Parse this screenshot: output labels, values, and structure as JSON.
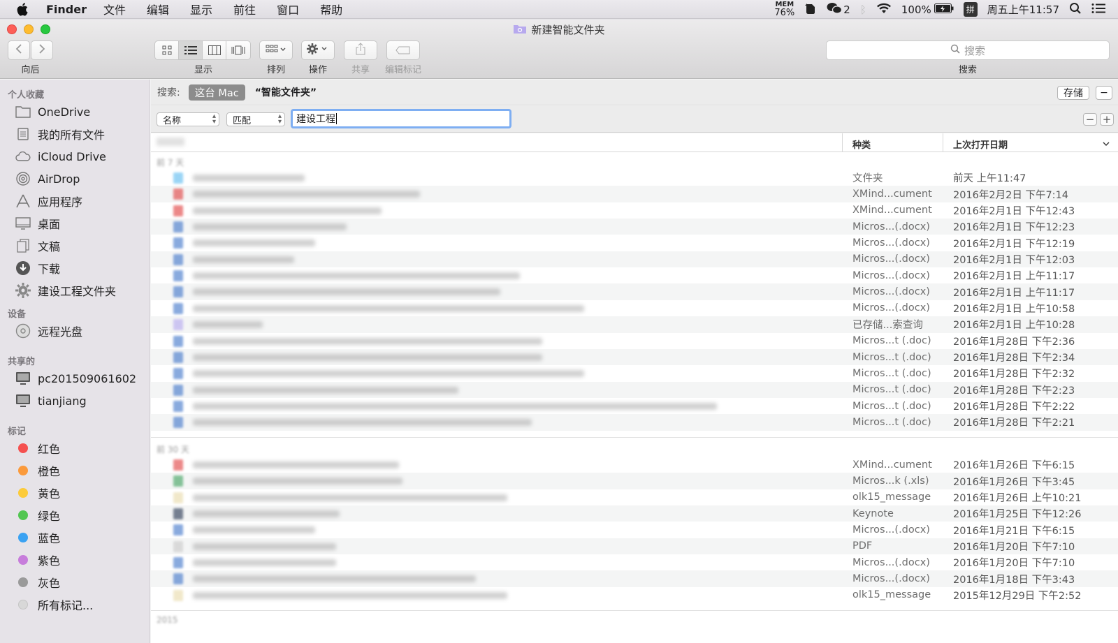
{
  "menubar": {
    "app": "Finder",
    "items": [
      "文件",
      "编辑",
      "显示",
      "前往",
      "窗口",
      "帮助"
    ],
    "mem_label": "MEM",
    "mem_value": "76%",
    "wechat_count": "2",
    "battery": "100%",
    "ime": "拼",
    "clock": "周五上午11:57"
  },
  "window": {
    "title": "新建智能文件夹",
    "toolbar": {
      "back_label": "向后",
      "view_label": "显示",
      "arrange_label": "排列",
      "action_label": "操作",
      "share_label": "共享",
      "tags_label": "编辑标记",
      "search_placeholder": "搜索",
      "search_label": "搜索"
    }
  },
  "sidebar": {
    "favorites_header": "个人收藏",
    "favorites": [
      {
        "label": "OneDrive",
        "icon": "folder-icon"
      },
      {
        "label": "我的所有文件",
        "icon": "all-files-icon"
      },
      {
        "label": "iCloud Drive",
        "icon": "cloud-icon"
      },
      {
        "label": "AirDrop",
        "icon": "airdrop-icon"
      },
      {
        "label": "应用程序",
        "icon": "applications-icon"
      },
      {
        "label": "桌面",
        "icon": "desktop-icon"
      },
      {
        "label": "文稿",
        "icon": "documents-icon"
      },
      {
        "label": "下载",
        "icon": "download-icon"
      },
      {
        "label": "建设工程文件夹",
        "icon": "gear-icon"
      }
    ],
    "devices_header": "设备",
    "devices": [
      {
        "label": "远程光盘",
        "icon": "disc-icon"
      }
    ],
    "shared_header": "共享的",
    "shared": [
      {
        "label": "pc201509061602",
        "icon": "computer-icon"
      },
      {
        "label": "tianjiang",
        "icon": "computer-icon"
      }
    ],
    "tags_header": "标记",
    "tags": [
      {
        "label": "红色",
        "color": "#f5504f"
      },
      {
        "label": "橙色",
        "color": "#fb9a3b"
      },
      {
        "label": "黄色",
        "color": "#fccb3a"
      },
      {
        "label": "绿色",
        "color": "#52c651"
      },
      {
        "label": "蓝色",
        "color": "#3aa2f2"
      },
      {
        "label": "紫色",
        "color": "#c77ddb"
      },
      {
        "label": "灰色",
        "color": "#9a9a9a"
      }
    ],
    "all_tags": "所有标记..."
  },
  "scope": {
    "label": "搜索:",
    "this_mac": "这台 Mac",
    "smart_folder": "“智能文件夹”",
    "save": "存储",
    "minus": "−"
  },
  "criteria": {
    "attribute": "名称",
    "operator": "匹配",
    "value": "建设工程",
    "minus": "−",
    "plus": "+"
  },
  "list": {
    "col_kind": "种类",
    "col_date": "上次打开日期",
    "group1": "前 7 天",
    "group2": "前 30 天",
    "group3": "2015",
    "rows1": [
      {
        "kind": "文件夹",
        "date": "前天 上午11:47",
        "icolor": "#58b9f0",
        "w": 160
      },
      {
        "kind": "XMind...cument",
        "date": "2016年2月2日 下午7:14",
        "icolor": "#e03a3a",
        "w": 325
      },
      {
        "kind": "XMind...cument",
        "date": "2016年2月1日 下午12:43",
        "icolor": "#e03a3a",
        "w": 270
      },
      {
        "kind": "Micros...(.docx)",
        "date": "2016年2月1日 下午12:23",
        "icolor": "#3b72c9",
        "w": 220
      },
      {
        "kind": "Micros...(.docx)",
        "date": "2016年2月1日 下午12:19",
        "icolor": "#3b72c9",
        "w": 175
      },
      {
        "kind": "Micros...(.docx)",
        "date": "2016年2月1日 下午12:03",
        "icolor": "#3b72c9",
        "w": 145
      },
      {
        "kind": "Micros...(.docx)",
        "date": "2016年2月1日 上午11:17",
        "icolor": "#3b72c9",
        "w": 468
      },
      {
        "kind": "Micros...(.docx)",
        "date": "2016年2月1日 上午11:17",
        "icolor": "#3b72c9",
        "w": 440
      },
      {
        "kind": "Micros...(.docx)",
        "date": "2016年2月1日 上午10:58",
        "icolor": "#3b72c9",
        "w": 560
      },
      {
        "kind": "已存储...索查询",
        "date": "2016年2月1日 上午10:28",
        "icolor": "#b3a6f0",
        "w": 100
      },
      {
        "kind": "Micros...t (.doc)",
        "date": "2016年1月28日 下午2:36",
        "icolor": "#3b72c9",
        "w": 500
      },
      {
        "kind": "Micros...t (.doc)",
        "date": "2016年1月28日 下午2:34",
        "icolor": "#3b72c9",
        "w": 500
      },
      {
        "kind": "Micros...t (.doc)",
        "date": "2016年1月28日 下午2:32",
        "icolor": "#3b72c9",
        "w": 560
      },
      {
        "kind": "Micros...t (.doc)",
        "date": "2016年1月28日 下午2:23",
        "icolor": "#3b72c9",
        "w": 380
      },
      {
        "kind": "Micros...t (.doc)",
        "date": "2016年1月28日 下午2:22",
        "icolor": "#3b72c9",
        "w": 750
      },
      {
        "kind": "Micros...t (.doc)",
        "date": "2016年1月28日 下午2:21",
        "icolor": "#3b72c9",
        "w": 485
      }
    ],
    "rows2": [
      {
        "kind": "XMind...cument",
        "date": "2016年1月26日 下午6:15",
        "icolor": "#e03a3a",
        "w": 295
      },
      {
        "kind": "Micros...k (.xls)",
        "date": "2016年1月26日 下午3:45",
        "icolor": "#3aa05a",
        "w": 300
      },
      {
        "kind": "olk15_message",
        "date": "2016年1月26日 上午10:21",
        "icolor": "#e8d9a8",
        "w": 450
      },
      {
        "kind": "Keynote",
        "date": "2016年1月25日 下午12:26",
        "icolor": "#22324e",
        "w": 210
      },
      {
        "kind": "Micros...(.docx)",
        "date": "2016年1月21日 下午6:15",
        "icolor": "#3b72c9",
        "w": 175
      },
      {
        "kind": "PDF",
        "date": "2016年1月20日 下午7:10",
        "icolor": "#c8c8c8",
        "w": 205
      },
      {
        "kind": "Micros...(.docx)",
        "date": "2016年1月20日 下午7:10",
        "icolor": "#3b72c9",
        "w": 205
      },
      {
        "kind": "Micros...(.docx)",
        "date": "2016年1月18日 下午3:43",
        "icolor": "#3b72c9",
        "w": 405
      },
      {
        "kind": "olk15_message",
        "date": "2015年12月29日 下午2:52",
        "icolor": "#e8d9a8",
        "w": 450
      }
    ]
  }
}
